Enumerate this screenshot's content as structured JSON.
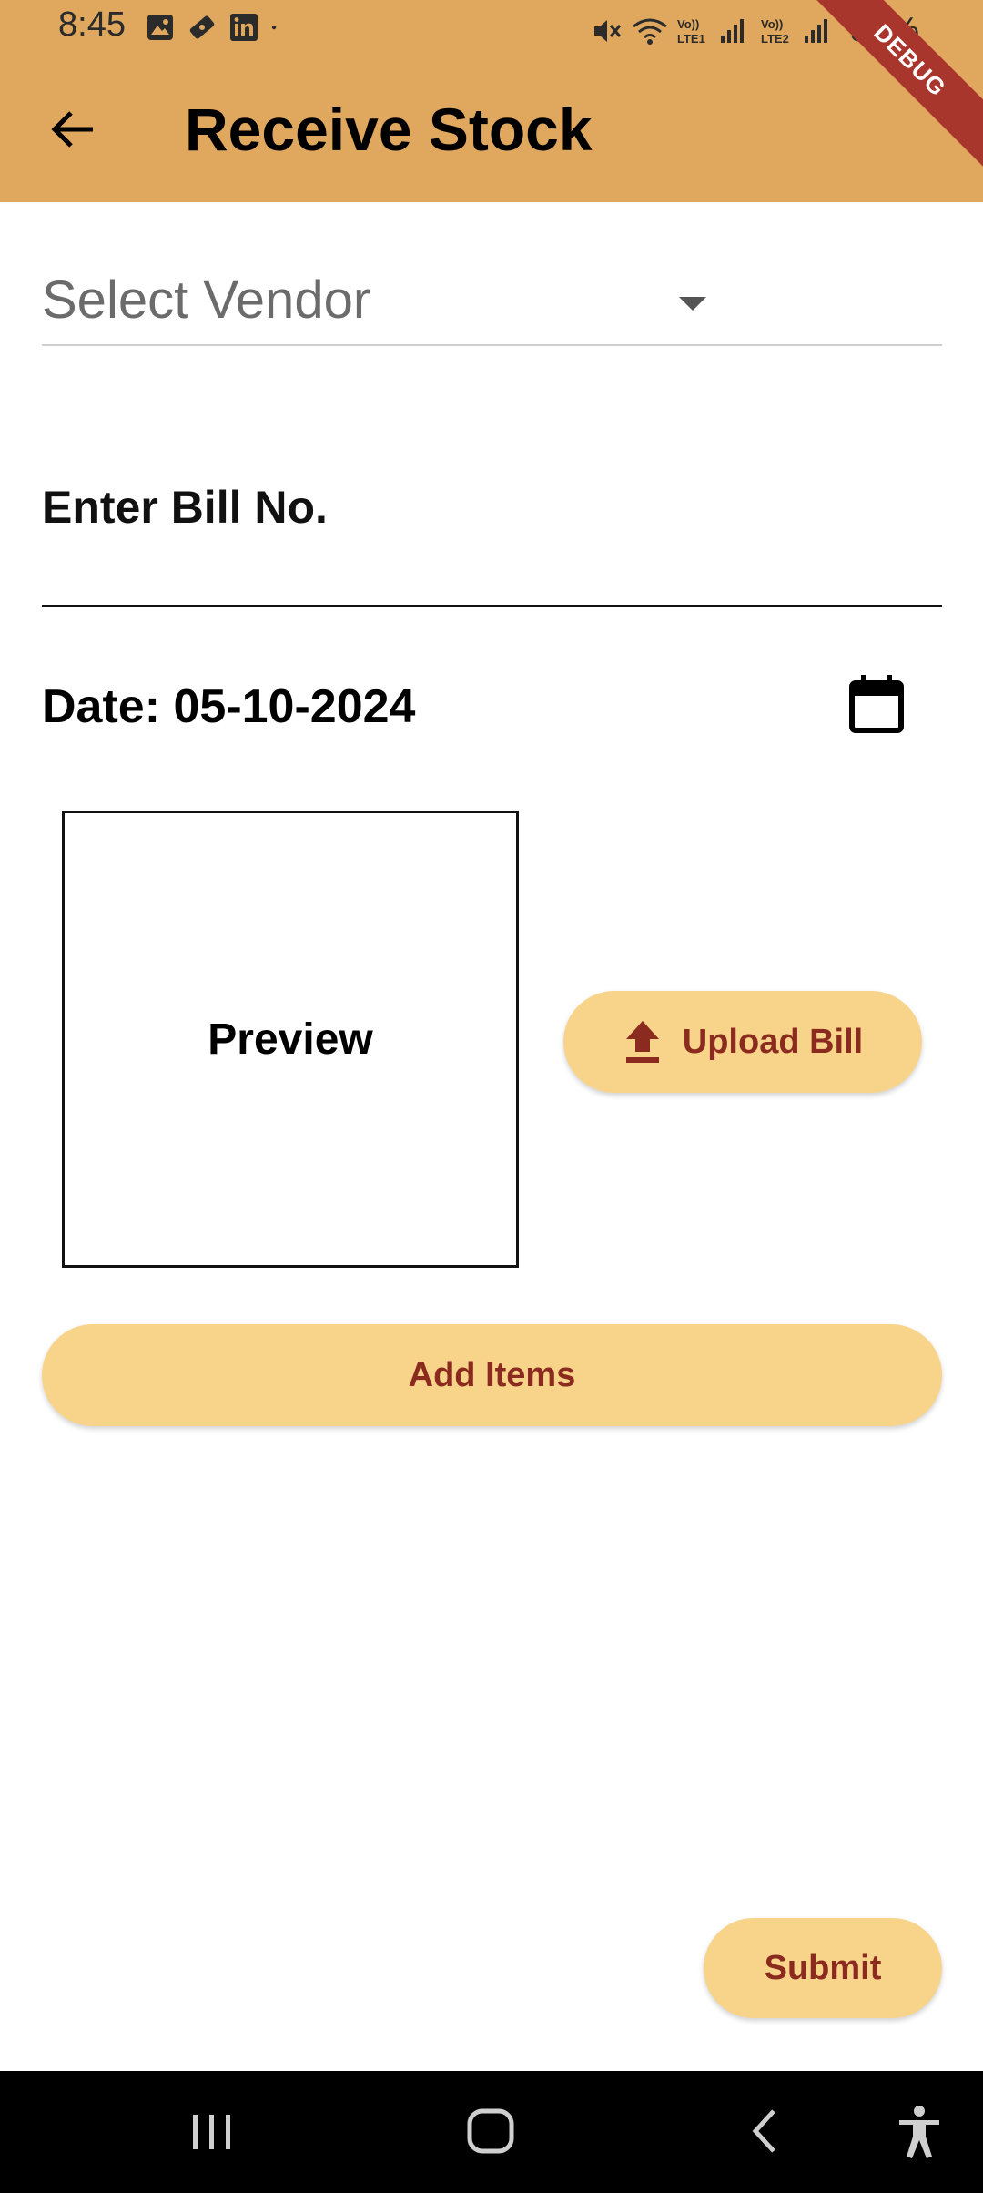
{
  "status_bar": {
    "time": "8:45",
    "battery": "56%",
    "icons_left": [
      "gallery-icon",
      "ticket-icon",
      "linkedin-icon",
      "dot-icon"
    ],
    "icons_right": [
      "mute-icon",
      "wifi-icon",
      "lte1-signal-icon",
      "lte2-signal-icon"
    ],
    "lte1_label": "Vo)) LTE1",
    "lte2_label": "Vo)) LTE2"
  },
  "debug_ribbon": "DEBUG",
  "app_bar": {
    "title": "Receive Stock",
    "back_icon": "arrow-left-icon"
  },
  "form": {
    "vendor_placeholder": "Select Vendor",
    "bill_no_label": "Enter Bill No.",
    "date_text": "Date: 05-10-2024",
    "preview_label": "Preview",
    "upload_label": "Upload Bill",
    "add_items_label": "Add Items",
    "submit_label": "Submit"
  },
  "colors": {
    "header": "#DFA85E",
    "button_bg": "#F8D48A",
    "button_text": "#8B2B1F",
    "debug_ribbon": "#A8362C"
  },
  "nav_bar": {
    "items": [
      "recents-icon",
      "home-icon",
      "back-icon",
      "accessibility-icon"
    ]
  }
}
